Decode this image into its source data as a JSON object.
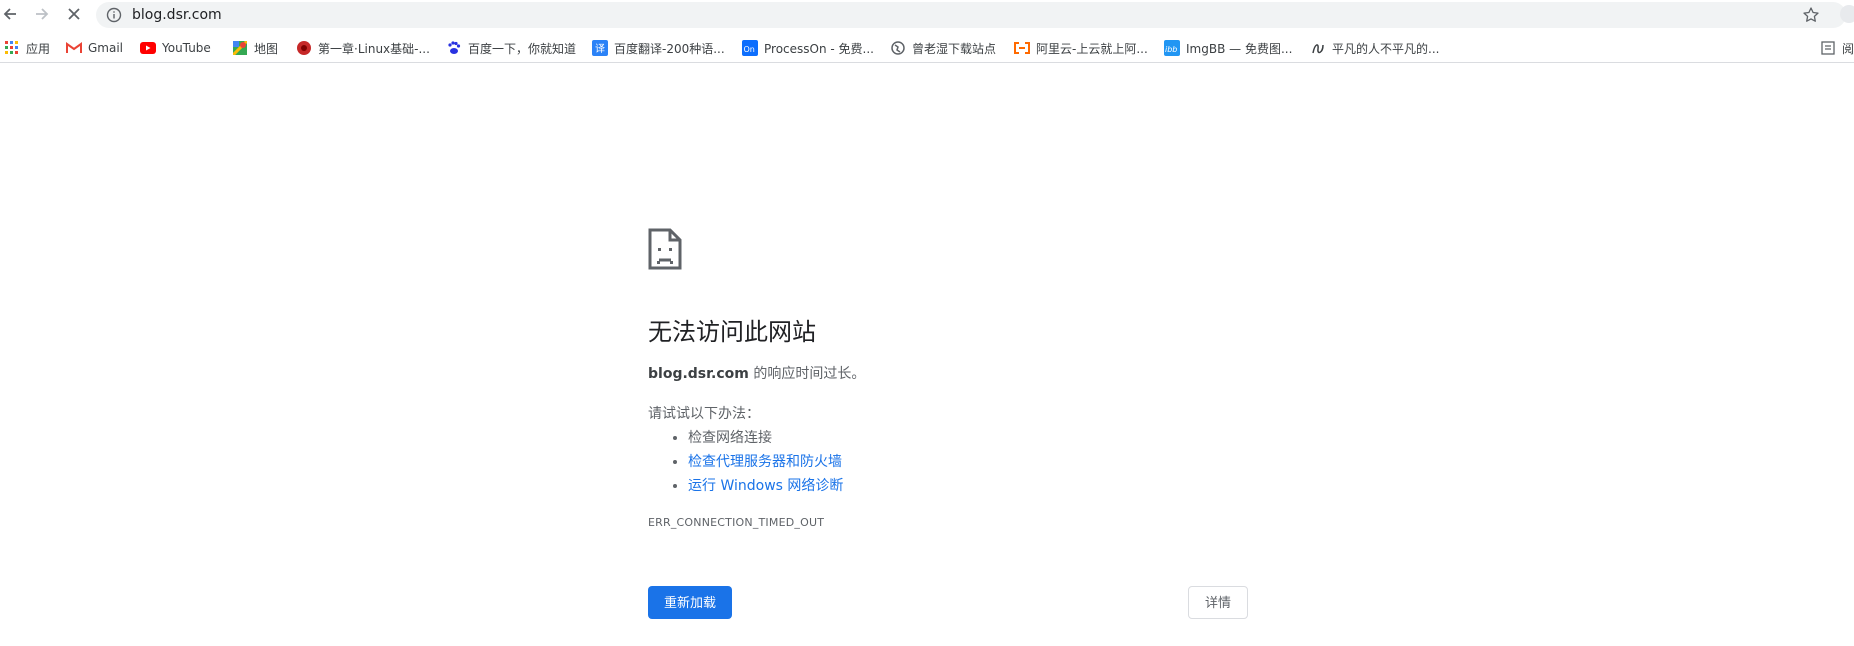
{
  "toolbar": {
    "url": "blog.dsr.com",
    "back_icon": "arrow-left-icon",
    "forward_icon": "arrow-right-icon",
    "stop_icon": "close-icon",
    "site_info_icon": "info-icon",
    "bookmark_star_icon": "star-icon"
  },
  "bookmarks": [
    {
      "label": "应用",
      "icon": "apps-grid-icon"
    },
    {
      "label": "Gmail",
      "icon": "gmail-icon"
    },
    {
      "label": "YouTube",
      "icon": "youtube-icon"
    },
    {
      "label": "地图",
      "icon": "maps-icon"
    },
    {
      "label": "第一章·Linux基础-...",
      "icon": "red-flower-icon"
    },
    {
      "label": "百度一下，你就知道",
      "icon": "baidu-paw-icon"
    },
    {
      "label": "百度翻译-200种语...",
      "icon": "baidu-translate-icon"
    },
    {
      "label": "ProcessOn - 免费...",
      "icon": "processon-icon"
    },
    {
      "label": "曾老湿下载站点",
      "icon": "globe-icon"
    },
    {
      "label": "阿里云-上云就上阿...",
      "icon": "aliyun-icon"
    },
    {
      "label": "ImgBB — 免费图...",
      "icon": "imgbb-icon"
    },
    {
      "label": "平凡的人不平凡的...",
      "icon": "script-logo-icon"
    }
  ],
  "reading_list_label": "阅",
  "error": {
    "title": "无法访问此网站",
    "host": "blog.dsr.com",
    "desc_suffix": " 的响应时间过长。",
    "try_label": "请试试以下办法：",
    "suggestions": [
      {
        "text": "检查网络连接",
        "link": false
      },
      {
        "text": "检查代理服务器和防火墙",
        "link": true
      },
      {
        "text": "运行 Windows 网络诊断",
        "link": true
      }
    ],
    "code": "ERR_CONNECTION_TIMED_OUT",
    "reload_label": "重新加载",
    "details_label": "详情"
  },
  "colors": {
    "accent": "#1a73e8",
    "text_secondary": "#5f6368",
    "omnibox_bg": "#f1f3f4"
  }
}
